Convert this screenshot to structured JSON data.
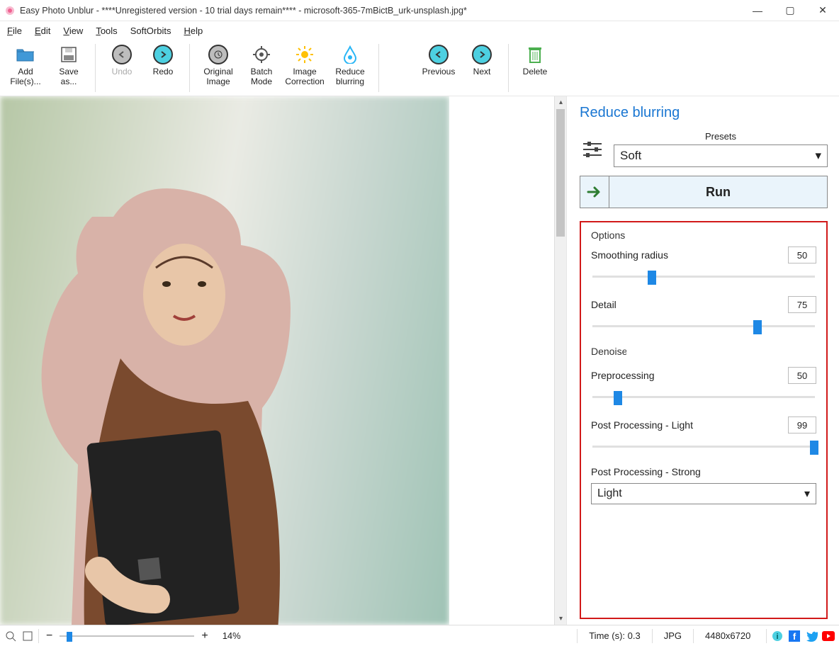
{
  "title": "Easy Photo Unblur - ****Unregistered version - 10 trial days remain**** - microsoft-365-7mBictB_urk-unsplash.jpg*",
  "menu": {
    "file": "File",
    "edit": "Edit",
    "view": "View",
    "tools": "Tools",
    "softorbits": "SoftOrbits",
    "help": "Help"
  },
  "toolbar": {
    "add_files": "Add\nFile(s)...",
    "save_as": "Save\nas...",
    "undo": "Undo",
    "redo": "Redo",
    "original": "Original\nImage",
    "batch": "Batch\nMode",
    "correction": "Image\nCorrection",
    "reduce": "Reduce\nblurring",
    "previous": "Previous",
    "next": "Next",
    "delete": "Delete"
  },
  "panel": {
    "title": "Reduce blurring",
    "presets_label": "Presets",
    "preset_value": "Soft",
    "run_label": "Run",
    "options_label": "Options",
    "smoothing": {
      "label": "Smoothing radius",
      "value": "50",
      "pct": 25
    },
    "detail": {
      "label": "Detail",
      "value": "75",
      "pct": 72
    },
    "denoise": "Denoise",
    "preproc": {
      "label": "Preprocessing",
      "value": "50",
      "pct": 10
    },
    "postlight": {
      "label": "Post Processing - Light",
      "value": "99",
      "pct": 99
    },
    "poststrong_label": "Post Processing - Strong",
    "poststrong_value": "Light"
  },
  "status": {
    "time": "Time (s): 0.3",
    "format": "JPG",
    "dims": "4480x6720",
    "zoom": "14%"
  }
}
